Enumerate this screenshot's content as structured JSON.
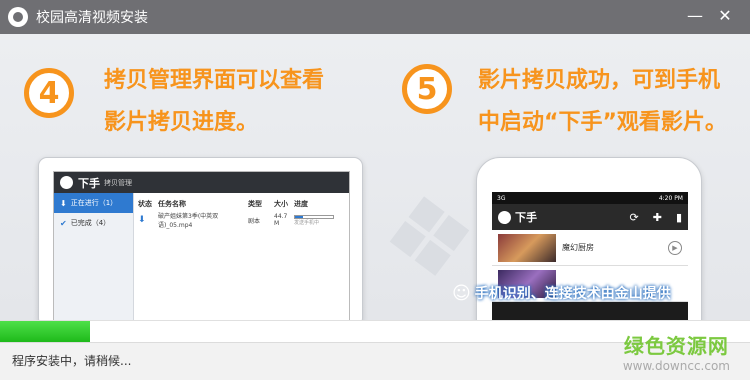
{
  "window": {
    "title": "校园高清视频安装",
    "min_label": "—",
    "close_label": "✕"
  },
  "steps": [
    {
      "number": "4",
      "line1": "拷贝管理界面可以查看",
      "line2": "影片拷贝进度。"
    },
    {
      "number": "5",
      "line1": "影片拷贝成功，可到手机",
      "line2": "中启动“下手”观看影片。"
    }
  ],
  "desktop_app": {
    "name": "下手",
    "subtitle": "拷贝管理",
    "sidebar": [
      {
        "label": "正在进行（1）",
        "icon": "download-icon",
        "active": true
      },
      {
        "label": "已完成（4）",
        "icon": "check-icon",
        "active": false
      }
    ],
    "columns": [
      "状态",
      "任务名称",
      "类型",
      "大小",
      "进度"
    ],
    "rows": [
      {
        "status_icon": "download-arrow-icon",
        "name": "破产姐妹第3季(中英双语)_05.mp4",
        "type": "剧本",
        "size": "44.7 M",
        "progress": 0.2,
        "progress_note": "发送手机中"
      }
    ]
  },
  "phone_app": {
    "status_left": "3G",
    "status_right": "4:20 PM",
    "name": "下手",
    "icons": [
      "refresh-icon",
      "gamepad-icon",
      "trash-icon"
    ],
    "items": [
      {
        "title": "魔幻厨房",
        "thumb": "movie-poster-1"
      },
      {
        "title": "",
        "thumb": "movie-poster-2"
      }
    ]
  },
  "tech_note": {
    "text": "手机识别、连接技术由金山提供",
    "icon": "android-icon"
  },
  "install": {
    "progress": 0.12,
    "status_text": "程序安装中，请稍候..."
  },
  "watermark": {
    "cn": "绿色资源网",
    "url": "www.downcc.com"
  },
  "colors": {
    "accent": "#f7941d",
    "titlebar": "#6f6f73",
    "progress": "#2bc427",
    "brand_green": "#7cc940"
  }
}
